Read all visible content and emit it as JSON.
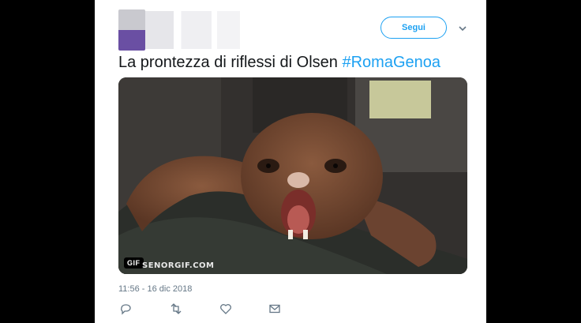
{
  "tweet": {
    "follow_label": "Segui",
    "text": "La prontezza di riflessi di Olsen ",
    "hashtag": "#RomaGenoa",
    "timestamp": "11:56 - 16 dic 2018"
  },
  "media": {
    "badge": "GIF",
    "watermark": "SENORGIF.COM"
  },
  "icons": {
    "more": "chevron-down-icon",
    "reply": "reply-icon",
    "retweet": "retweet-icon",
    "like": "heart-icon",
    "message": "envelope-icon"
  },
  "colors": {
    "accent": "#1da1f2",
    "text": "#14171a",
    "muted": "#657786"
  }
}
